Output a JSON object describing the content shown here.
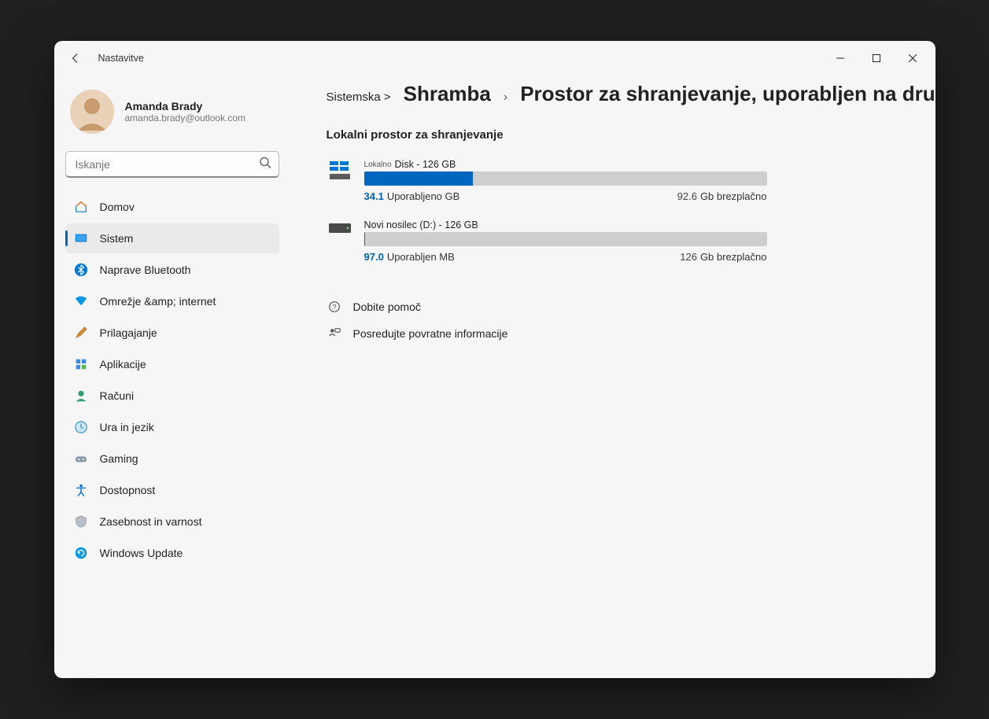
{
  "window": {
    "title": "Nastavitve"
  },
  "profile": {
    "name": "Amanda Brady",
    "email": "amanda.brady@outlook.com"
  },
  "search": {
    "placeholder": "Iskanje"
  },
  "sidebar": {
    "items": [
      {
        "label": "Domov"
      },
      {
        "label": "Sistem"
      },
      {
        "label": "Naprave Bluetooth"
      },
      {
        "label": "Omrežje &amp; internet"
      },
      {
        "label": "Prilagajanje"
      },
      {
        "label": "Aplikacije"
      },
      {
        "label": "Računi"
      },
      {
        "label": "Ura in jezik"
      },
      {
        "label": "Gaming"
      },
      {
        "label": "Dostopnost"
      },
      {
        "label": "Zasebnost in varnost"
      },
      {
        "label": "Windows Update"
      }
    ]
  },
  "breadcrumb": {
    "seg1": "Sistemska >",
    "seg2": "Shramba",
    "seg3": "Prostor za shranjevanje, uporabljen na drugih pogonih"
  },
  "section": {
    "title": "Lokalni prostor za shranjevanje"
  },
  "drives": [
    {
      "localTag": "Lokalno",
      "name": "Disk - 126 GB",
      "usedValue": "34.1",
      "usedLabel": "Uporabljeno GB",
      "freeValue": "92.6",
      "freeLabel": "Gb brezplačno",
      "fillPercent": 27
    },
    {
      "localTag": "",
      "name": "Novi nosilec (D:) - 126 GB",
      "usedValue": "97.0",
      "usedLabel": "Uporabljen MB",
      "freeValue": "126",
      "freeLabel": "Gb brezplačno",
      "fillPercent": 0.1
    }
  ],
  "links": {
    "help": "Dobite pomoč",
    "feedback": "Posredujte povratne informacije"
  }
}
